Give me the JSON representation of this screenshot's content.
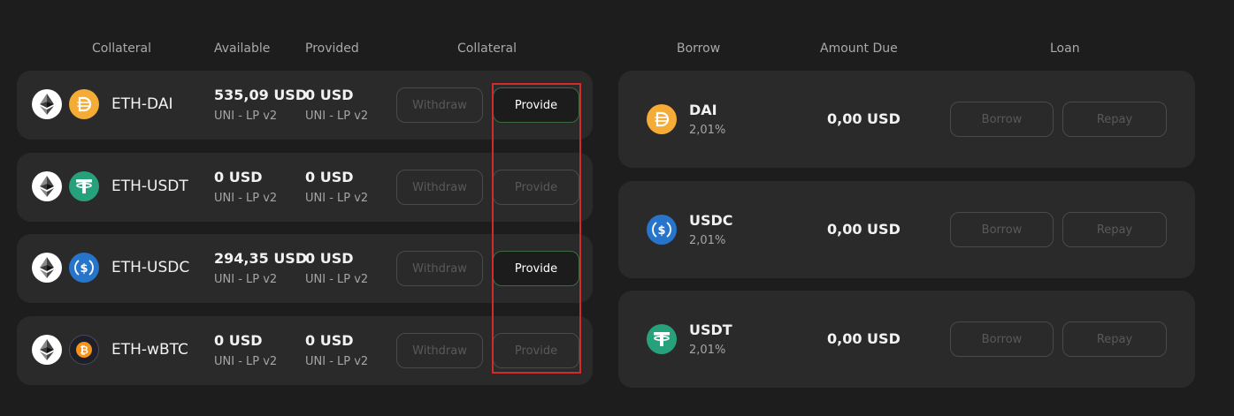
{
  "headers": {
    "collateral": "Collateral",
    "available": "Available",
    "provided": "Provided",
    "collateral_actions": "Collateral",
    "borrow": "Borrow",
    "amount_due": "Amount Due",
    "loan": "Loan"
  },
  "collateral_rows": [
    {
      "pair": "ETH-DAI",
      "available": "535,09 USD",
      "available_sub": "UNI - LP v2",
      "provided": "0 USD",
      "provided_sub": "UNI - LP v2",
      "withdraw_label": "Withdraw",
      "provide_label": "Provide",
      "provide_enabled": true,
      "icons": [
        "eth-icon",
        "dai-icon"
      ]
    },
    {
      "pair": "ETH-USDT",
      "available": "0 USD",
      "available_sub": "UNI - LP v2",
      "provided": "0 USD",
      "provided_sub": "UNI - LP v2",
      "withdraw_label": "Withdraw",
      "provide_label": "Provide",
      "provide_enabled": false,
      "icons": [
        "eth-icon",
        "usdt-icon"
      ]
    },
    {
      "pair": "ETH-USDC",
      "available": "294,35 USD",
      "available_sub": "UNI - LP v2",
      "provided": "0 USD",
      "provided_sub": "UNI - LP v2",
      "withdraw_label": "Withdraw",
      "provide_label": "Provide",
      "provide_enabled": true,
      "icons": [
        "eth-icon",
        "usdc-icon"
      ]
    },
    {
      "pair": "ETH-wBTC",
      "available": "0 USD",
      "available_sub": "UNI - LP v2",
      "provided": "0 USD",
      "provided_sub": "UNI - LP v2",
      "withdraw_label": "Withdraw",
      "provide_label": "Provide",
      "provide_enabled": false,
      "icons": [
        "eth-icon",
        "wbtc-icon"
      ]
    }
  ],
  "borrow_rows": [
    {
      "asset": "DAI",
      "rate": "2,01%",
      "amount_due": "0,00 USD",
      "borrow_label": "Borrow",
      "repay_label": "Repay",
      "icon": "dai-icon"
    },
    {
      "asset": "USDC",
      "rate": "2,01%",
      "amount_due": "0,00 USD",
      "borrow_label": "Borrow",
      "repay_label": "Repay",
      "icon": "usdc-icon"
    },
    {
      "asset": "USDT",
      "rate": "2,01%",
      "amount_due": "0,00 USD",
      "borrow_label": "Borrow",
      "repay_label": "Repay",
      "icon": "usdt-icon"
    }
  ],
  "colors": {
    "background": "#1d1d1d",
    "card": "#2a2a2a",
    "active_border": "#3c6b42",
    "highlight": "#d22b2b",
    "dai": "#f5ac37",
    "usdt": "#26a17b",
    "usdc": "#2775ca",
    "wbtc": "#f7931a"
  }
}
